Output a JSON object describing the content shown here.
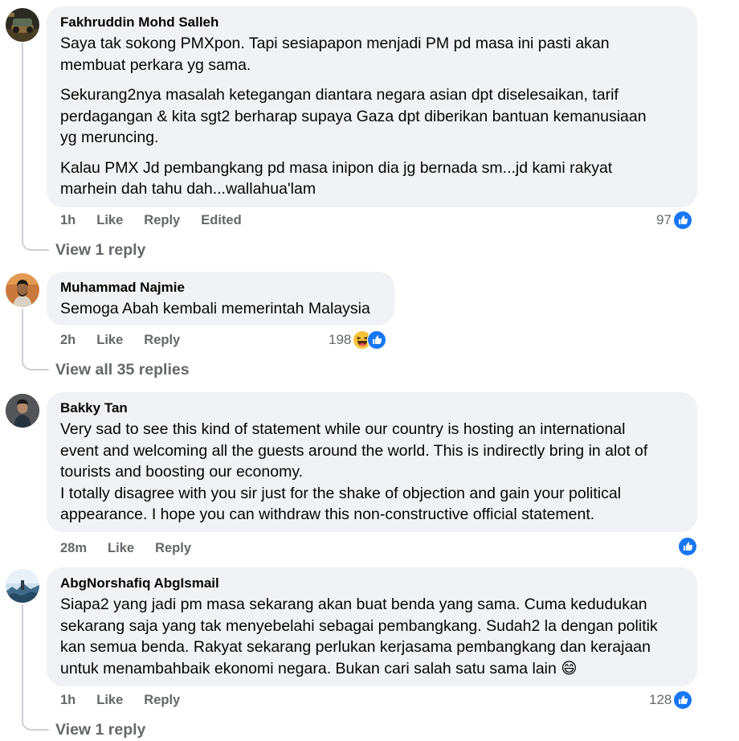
{
  "comments": [
    {
      "author": "Fakhruddin Mohd Salleh",
      "paragraphs": [
        "Saya tak sokong PMXpon. Tapi sesiapapon menjadi PM pd masa ini pasti akan\nmembuat perkara yg sama.",
        "Sekurang2nya masalah ketegangan diantara negara asian dpt diselesaikan, tarif\nperdagangan & kita sgt2 berharap supaya Gaza dpt diberikan bantuan kemanusiaan\nyg meruncing.",
        "Kalau PMX Jd pembangkang pd masa inipon dia jg bernada sm...jd kami rakyat\nmarhein dah tahu dah...wallahua'lam"
      ],
      "time": "1h",
      "like_label": "Like",
      "reply_label": "Reply",
      "edited_label": "Edited",
      "reaction_count": "97",
      "view_replies": "View 1 reply"
    },
    {
      "author": "Muhammad Najmie",
      "paragraphs": [
        "Semoga Abah kembali memerintah Malaysia"
      ],
      "time": "2h",
      "like_label": "Like",
      "reply_label": "Reply",
      "reaction_count": "198",
      "view_replies": "View all 35 replies"
    },
    {
      "author": "Bakky Tan",
      "paragraphs": [
        "Very sad to see this kind of statement while our country is hosting an international\nevent and welcoming all the guests around the world. This is indirectly bring in alot of\ntourists and boosting our economy.",
        "I totally disagree with you sir just for the shake of objection and gain your political\nappearance. I hope you can withdraw this non-constructive official statement."
      ],
      "time": "28m",
      "like_label": "Like",
      "reply_label": "Reply",
      "reaction_count": ""
    },
    {
      "author": "AbgNorshafiq AbgIsmail",
      "paragraphs": [
        "Siapa2 yang jadi pm masa sekarang akan buat benda yang sama. Cuma kedudukan\nsekarang saja yang tak menyebelahi sebagai pembangkang. Sudah2 la dengan politik\nkan semua benda. Rakyat sekarang perlukan kerjasama pembangkang dan kerajaan\nuntuk menambahbaik ekonomi negara. Bukan cari salah satu sama lain 😄"
      ],
      "time": "1h",
      "like_label": "Like",
      "reply_label": "Reply",
      "reaction_count": "128",
      "view_replies": "View 1 reply"
    }
  ],
  "icons": {
    "like": "like-reaction-icon",
    "haha": "haha-reaction-icon"
  },
  "colors": {
    "bubble": "#f0f2f5",
    "secondary_text": "#65676b",
    "like_blue": "#1877f2"
  }
}
